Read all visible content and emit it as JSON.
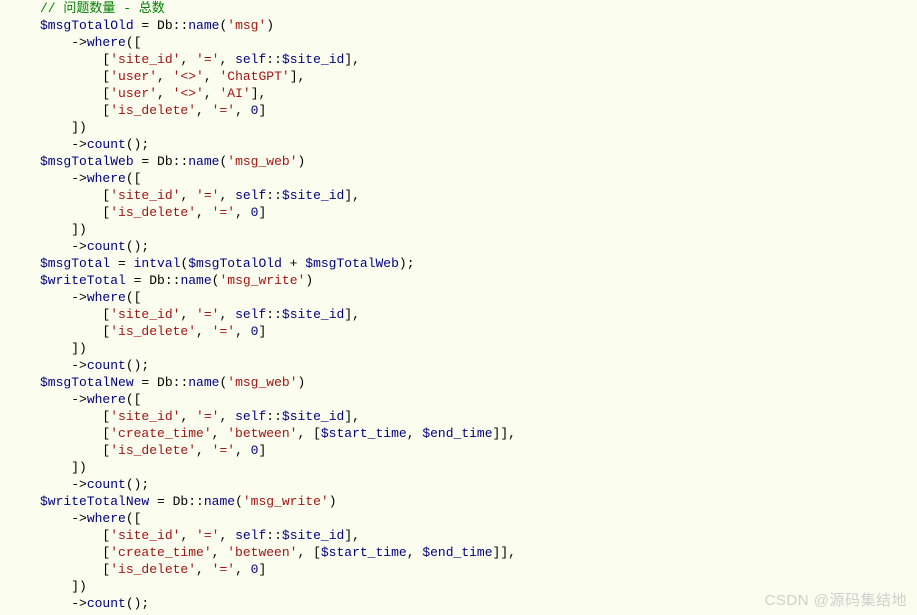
{
  "code": {
    "comment1": "// 问题数量 - 总数",
    "var_msgTotalOld": "$msgTotalOld",
    "var_msgTotalWeb": "$msgTotalWeb",
    "var_msgTotal": "$msgTotal",
    "var_writeTotal": "$writeTotal",
    "var_msgTotalNew": "$msgTotalNew",
    "var_writeTotalNew": "$writeTotalNew",
    "var_siteId": "$site_id",
    "var_startTime": "$start_time",
    "var_endTime": "$end_time",
    "cls_Db": "Db",
    "m_name": "name",
    "m_where": "where",
    "m_count": "count",
    "fn_intval": "intval",
    "kw_self": "self",
    "str_msg": "'msg'",
    "str_msg_web": "'msg_web'",
    "str_msg_write": "'msg_write'",
    "str_site_id": "'site_id'",
    "str_eq": "'='",
    "str_ne": "'<>'",
    "str_user": "'user'",
    "str_ChatGPT": "'ChatGPT'",
    "str_AI": "'AI'",
    "str_is_delete": "'is_delete'",
    "str_create_time": "'create_time'",
    "str_between": "'between'",
    "num_zero": "0"
  },
  "watermark": "CSDN @源码集结地"
}
